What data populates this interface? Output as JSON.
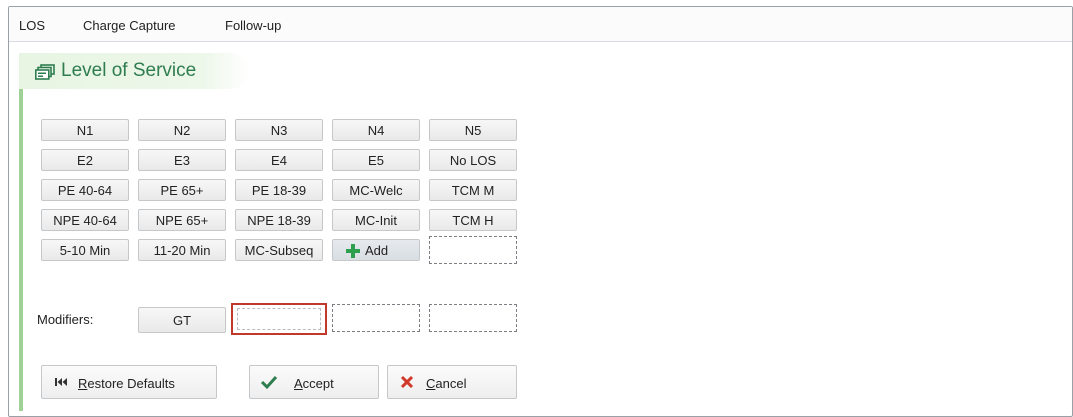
{
  "menubar": {
    "items": [
      "LOS",
      "Charge Capture",
      "Follow-up"
    ]
  },
  "section": {
    "title": "Level of Service",
    "icon": "level-of-service-icon"
  },
  "grid": {
    "rows": [
      [
        "N1",
        "N2",
        "N3",
        "N4",
        "N5"
      ],
      [
        "E2",
        "E3",
        "E4",
        "E5",
        "No LOS"
      ],
      [
        "PE 40-64",
        "PE 65+",
        "PE 18-39",
        "MC-Welc",
        "TCM M"
      ],
      [
        "NPE 40-64",
        "NPE 65+",
        "NPE 18-39",
        "MC-Init",
        "TCM H"
      ],
      [
        "5-10 Min",
        "11-20 Min",
        "MC-Subseq"
      ]
    ],
    "add_label": "Add"
  },
  "modifiers": {
    "label": "Modifiers:",
    "items": [
      "GT"
    ]
  },
  "actions": {
    "restore": "Restore Defaults",
    "accept": "Accept",
    "cancel": "Cancel"
  },
  "colors": {
    "accent_green": "#2e7d4f",
    "left_bar": "#9fd196",
    "selection_red": "#c0392b",
    "cancel_x": "#d0382b",
    "accept_check": "#2e7d4f"
  }
}
